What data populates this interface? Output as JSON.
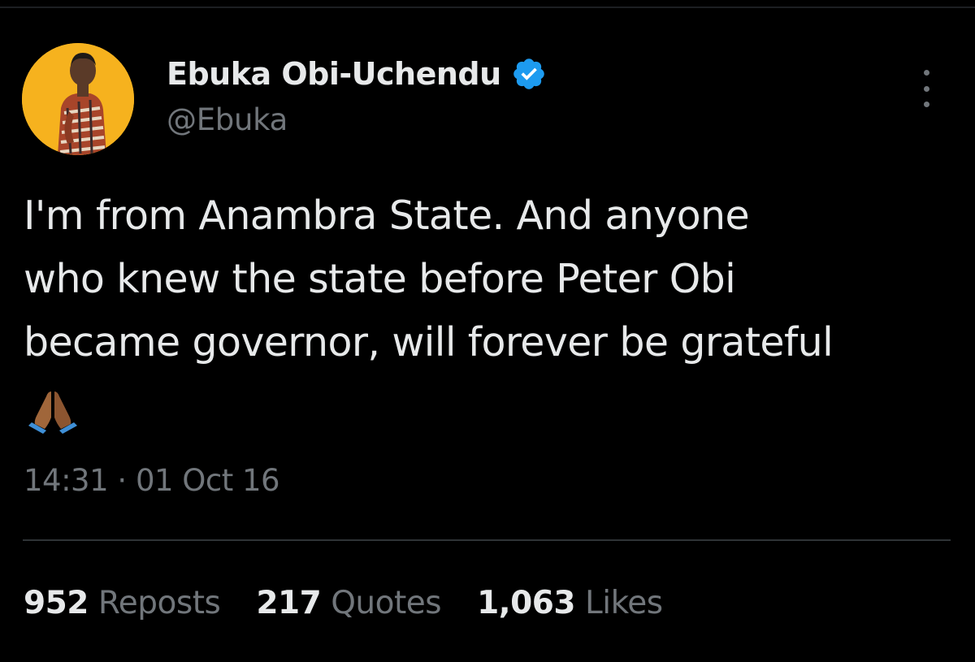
{
  "author": {
    "display_name": "Ebuka Obi-Uchendu",
    "handle": "@Ebuka",
    "verified": true,
    "avatar_bg": "#f6b21e"
  },
  "tweet": {
    "lines": [
      "I'm from Anambra State. And anyone",
      "who knew the state before Peter Obi",
      "became governor, will forever be grateful"
    ],
    "emoji": "folded-hands-emoji",
    "time": "14:31",
    "separator": "·",
    "date": "01 Oct 16"
  },
  "stats": {
    "reposts": {
      "count": "952",
      "label": "Reposts"
    },
    "quotes": {
      "count": "217",
      "label": "Quotes"
    },
    "likes": {
      "count": "1,063",
      "label": "Likes"
    }
  },
  "colors": {
    "background": "#000000",
    "text": "#e7e9ea",
    "secondary": "#71767b",
    "verified_badge": "#1d9bf0",
    "divider": "#2f3336"
  }
}
